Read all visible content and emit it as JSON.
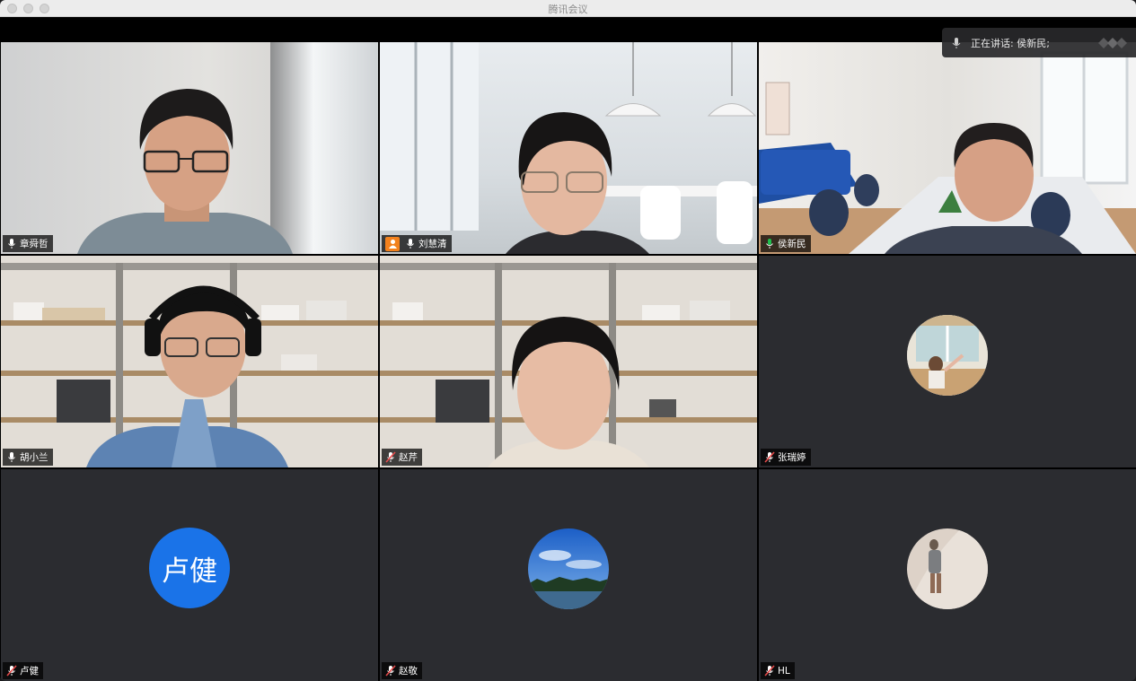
{
  "window": {
    "title": "腾讯会议"
  },
  "active_speaker": {
    "label": "正在讲话: 侯新民;"
  },
  "participants": [
    {
      "name": "章舜哲",
      "muted": false,
      "video": true,
      "host": false,
      "active": false
    },
    {
      "name": "刘慧清",
      "muted": false,
      "video": true,
      "host": true,
      "active": false
    },
    {
      "name": "侯新民",
      "muted": false,
      "video": true,
      "host": false,
      "active": true
    },
    {
      "name": "胡小兰",
      "muted": false,
      "video": true,
      "host": false,
      "active": false
    },
    {
      "name": "赵芹",
      "muted": true,
      "video": true,
      "host": false,
      "active": false
    },
    {
      "name": "张瑞婷",
      "muted": true,
      "video": false,
      "host": false,
      "active": false,
      "avatar": "photo"
    },
    {
      "name": "卢健",
      "muted": true,
      "video": false,
      "host": false,
      "active": false,
      "avatar": "initials",
      "initials": "卢健"
    },
    {
      "name": "赵敬",
      "muted": true,
      "video": false,
      "host": false,
      "active": false,
      "avatar": "photo"
    },
    {
      "name": "HL",
      "muted": true,
      "video": false,
      "host": false,
      "active": false,
      "avatar": "photo"
    }
  ],
  "colors": {
    "active_border": "#1fbf4e",
    "muted_icon": "#e84b4b",
    "avatar_blue": "#1a73e8",
    "host_badge": "#f2811d"
  },
  "icons": {
    "mic": "mic-icon",
    "mic_muted": "mic-muted-icon",
    "host": "host-icon"
  }
}
